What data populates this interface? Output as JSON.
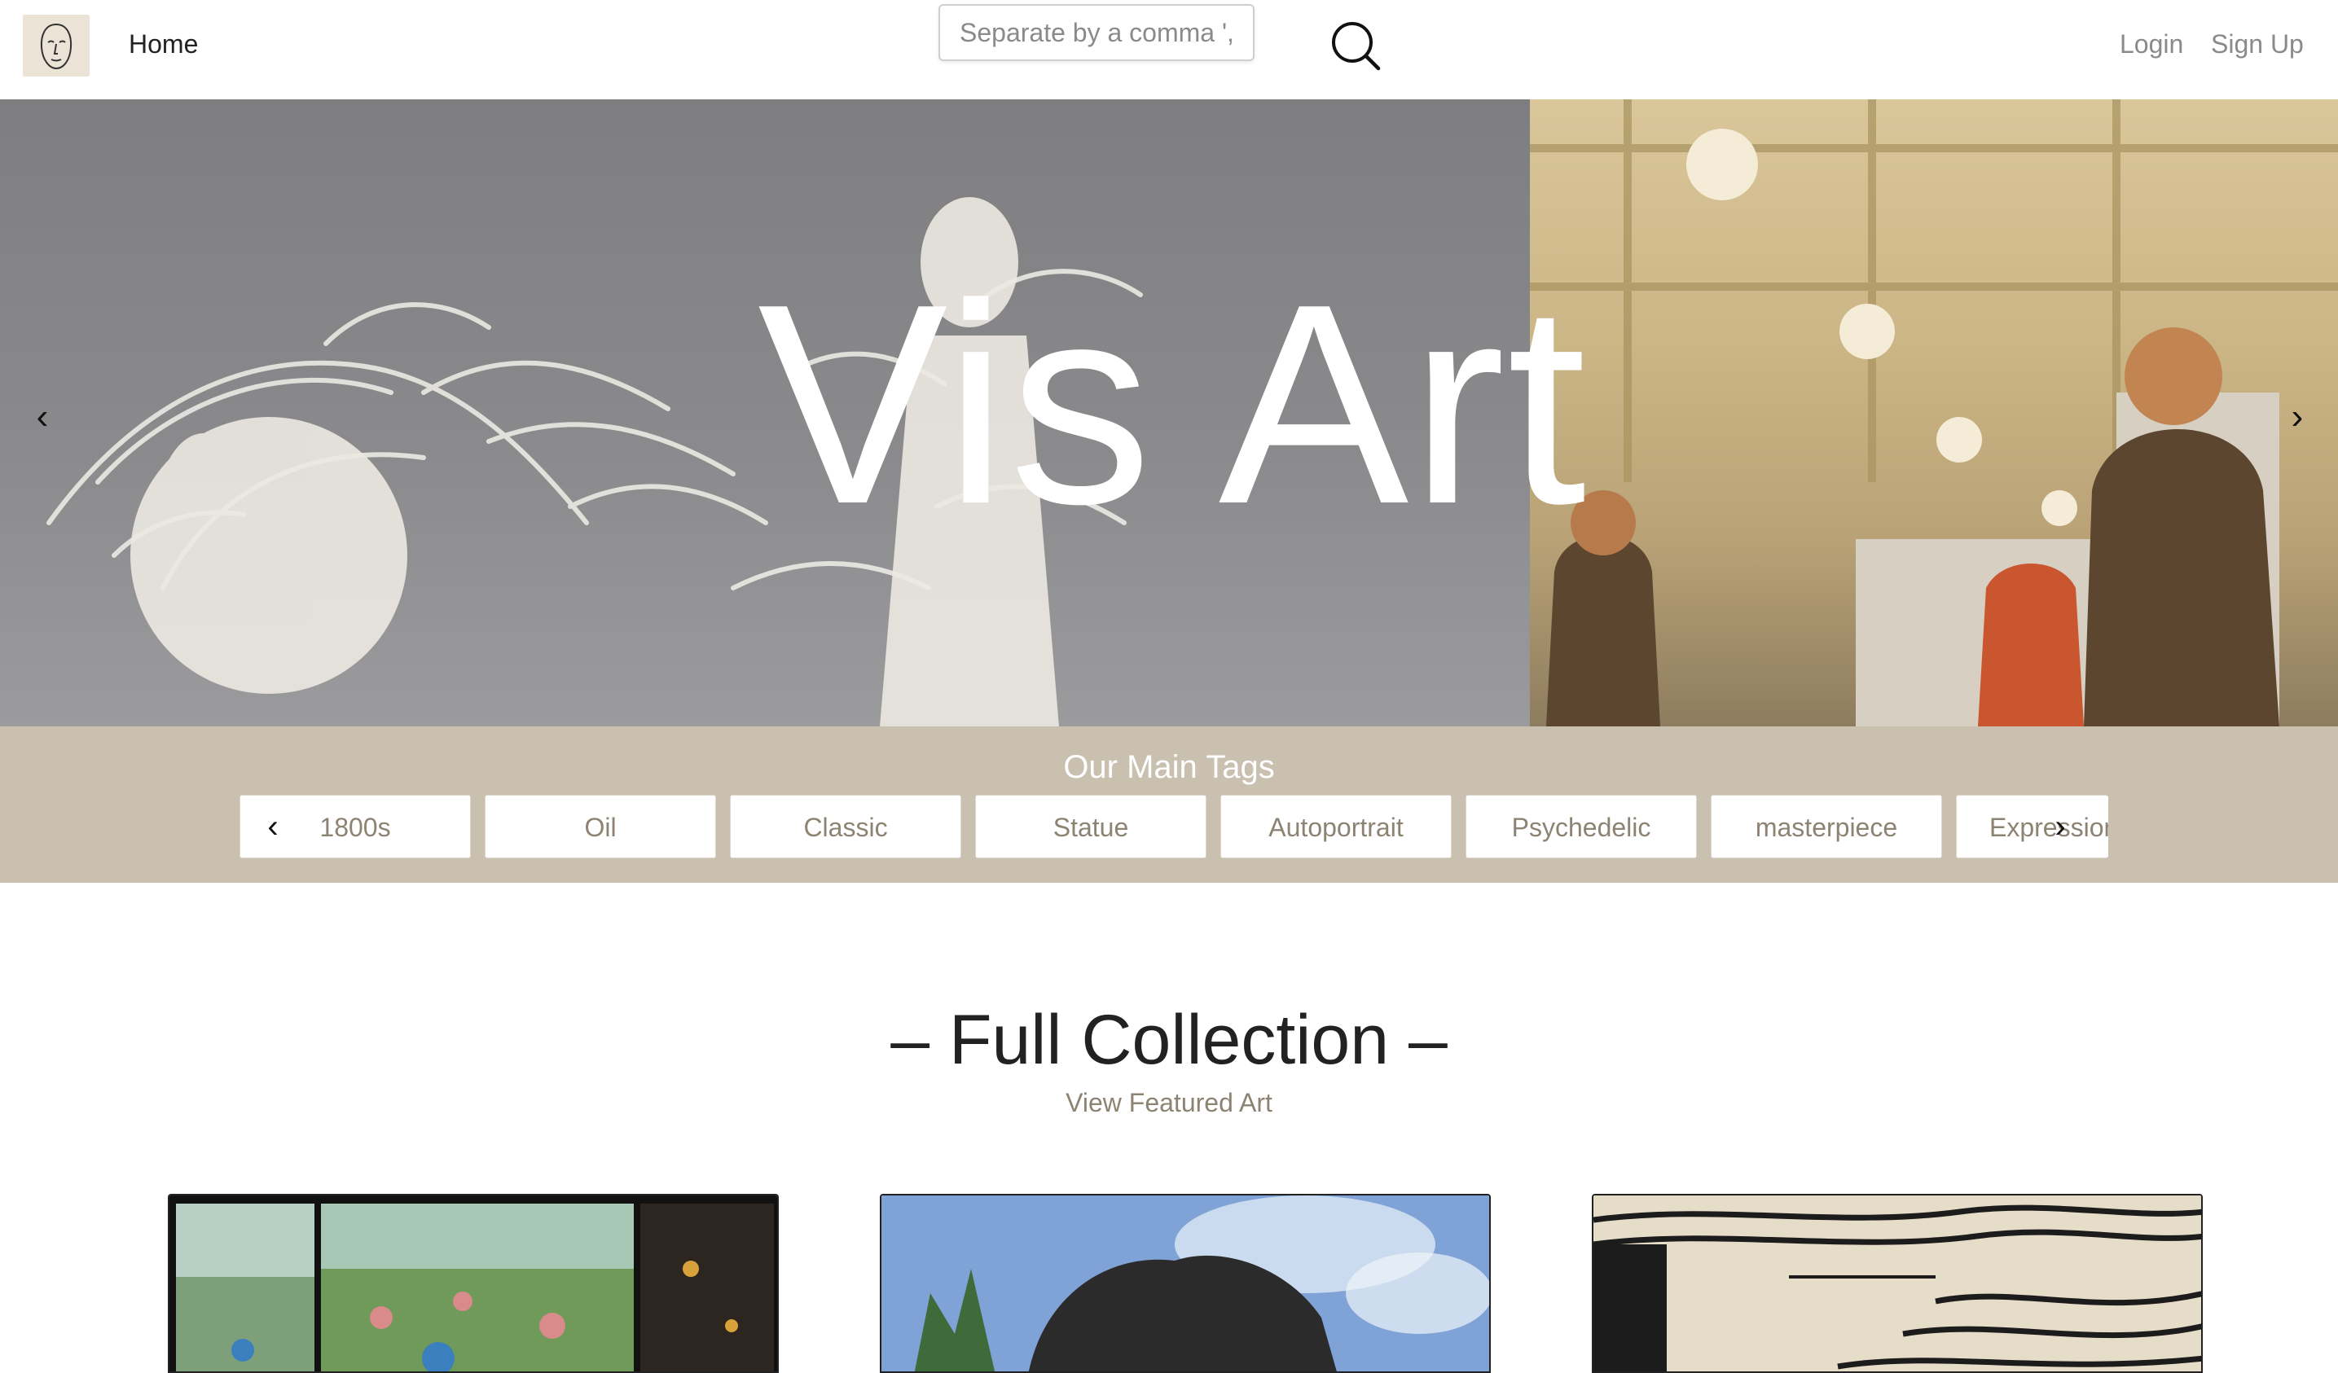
{
  "navbar": {
    "logo_icon": "face-line-drawing-icon",
    "home_label": "Home",
    "search_placeholder": "Separate by a comma ','",
    "search_icon": "search-icon",
    "login_label": "Login",
    "signup_label": "Sign Up"
  },
  "hero": {
    "title": "Vis Art",
    "prev_icon": "chevron-left-icon",
    "next_icon": "chevron-right-icon",
    "prev_glyph": "‹",
    "next_glyph": "›"
  },
  "tags": {
    "title": "Our Main Tags",
    "prev_glyph": "‹",
    "next_glyph": "›",
    "items": [
      "1800s",
      "Oil",
      "Classic",
      "Statue",
      "Autoportrait",
      "Psychedelic",
      "masterpiece",
      "Expression"
    ]
  },
  "collection": {
    "title": "– Full Collection –",
    "featured_link": "View Featured Art"
  },
  "colors": {
    "tag_band": "#c9c0b0",
    "tag_text": "#8d8372",
    "link": "#8d8372",
    "muted_nav": "#8a8a8a"
  }
}
